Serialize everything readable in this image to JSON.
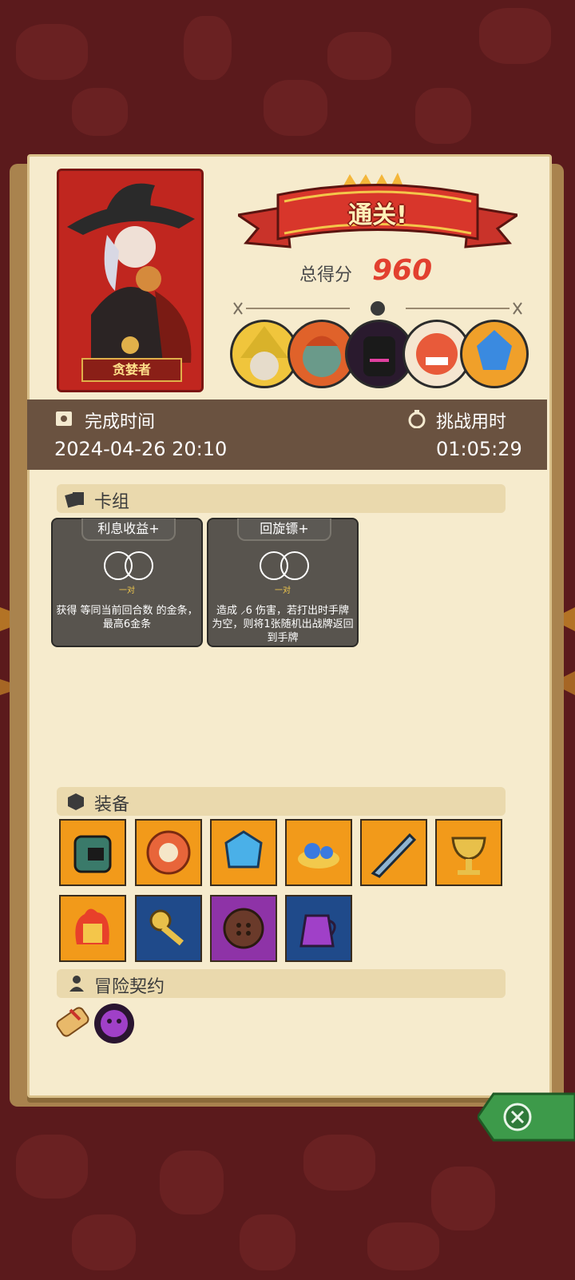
{
  "result": {
    "banner": "通关!",
    "score_label": "总得分",
    "score": "960"
  },
  "character": {
    "name": "贪婪者"
  },
  "times": {
    "complete_label": "完成时间",
    "complete_value": "2024-04-26 20:10",
    "challenge_label": "挑战用时",
    "challenge_value": "01:05:29"
  },
  "sections": {
    "deck": "卡组",
    "equipment": "装备",
    "contract": "冒险契约"
  },
  "cards": [
    {
      "title": "利息收益+",
      "sub": "一对",
      "desc": "获得 等同当前回合数 的金条，最高6金条"
    },
    {
      "title": "回旋镖+",
      "sub": "一对",
      "desc": "造成 ⸝6 伤害，若打出时手牌为空，则将1张随机出战牌返回到手牌"
    }
  ],
  "equipment": [
    {
      "name": "spiked-helmet-icon",
      "bg": "o"
    },
    {
      "name": "coin-shield-icon",
      "bg": "o"
    },
    {
      "name": "blue-crystal-icon",
      "bg": "o"
    },
    {
      "name": "blue-slime-icon",
      "bg": "o"
    },
    {
      "name": "broken-sword-icon",
      "bg": "o"
    },
    {
      "name": "golden-chalice-icon",
      "bg": "o"
    },
    {
      "name": "fire-cube-icon",
      "bg": "o"
    },
    {
      "name": "golden-key-icon",
      "bg": "b"
    },
    {
      "name": "button-coin-icon",
      "bg": "p"
    },
    {
      "name": "potion-jug-icon",
      "bg": "b"
    }
  ],
  "colors": {
    "orange": "#f29a1a",
    "blue": "#1f4a8a",
    "purple": "#8e33a7",
    "score_red": "#e2402f"
  }
}
